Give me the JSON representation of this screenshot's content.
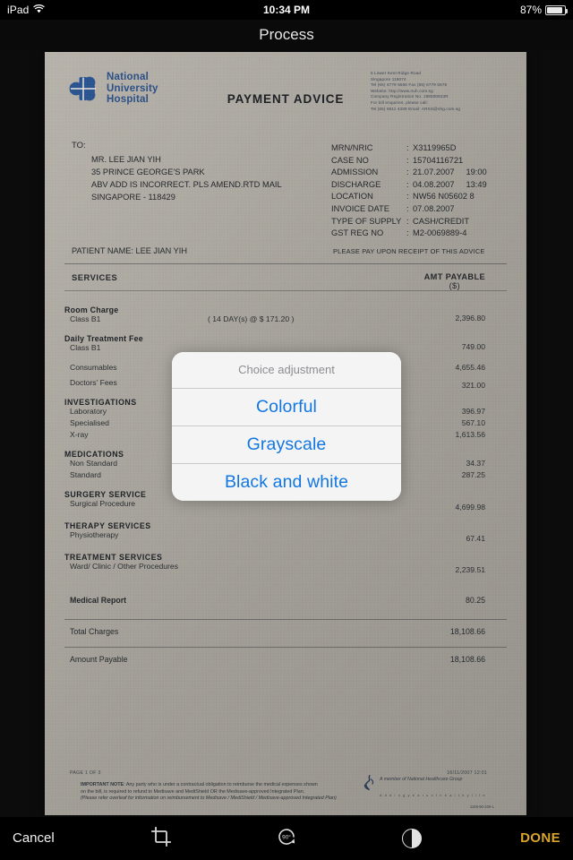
{
  "statusbar": {
    "device": "iPad",
    "wifi_icon": "wifi-icon",
    "time": "10:34 PM",
    "battery_percent": "87%",
    "battery_icon": "battery-icon"
  },
  "titlebar": {
    "title": "Process"
  },
  "document": {
    "logo": {
      "icon": "nuh-cross-logo-icon",
      "line1": "National",
      "line2": "University",
      "line3": "Hospital",
      "color": "#2a4f86"
    },
    "title": "PAYMENT ADVICE",
    "address_block": [
      "5 Lower Kent Ridge Road",
      "Singapore 119074",
      "Tel (65) 6779 5555 Fax (65) 6779 5678",
      "Website: http://www.nuh.com.sg",
      "Company Registration No. 198500843R",
      "For bill enquiries, please call:",
      "Tel (65) 6511 4338  Email: ARSS@nhg.com.sg"
    ],
    "to_label": "TO:",
    "to_lines": [
      "MR. LEE JIAN YIH",
      "35 PRINCE GEORGE'S PARK",
      "ABV ADD IS INCORRECT. PLS AMEND.RTD MAIL",
      "SINGAPORE - 118429"
    ],
    "meta": [
      {
        "key": "MRN/NRIC",
        "value": "X3119965D"
      },
      {
        "key": "CASE NO",
        "value": "15704116721"
      },
      {
        "key": "ADMISSION",
        "value": "21.07.2007     19:00"
      },
      {
        "key": "DISCHARGE",
        "value": "04.08.2007     13:49"
      },
      {
        "key": "LOCATION",
        "value": "NW56 N05602 8"
      },
      {
        "key": "INVOICE DATE",
        "value": "07.08.2007"
      },
      {
        "key": "TYPE OF SUPPLY",
        "value": "CASH/CREDIT"
      },
      {
        "key": "GST REG NO",
        "value": "M2-0069889-4"
      }
    ],
    "patient_name": "PATIENT NAME: LEE JIAN YIH",
    "pay_note": "PLEASE PAY UPON RECEIPT OF THIS ADVICE",
    "services_header": "SERVICES",
    "amount_header": "AMT PAYABLE",
    "amount_header_unit": "($)",
    "services": [
      {
        "group": "Room Charge",
        "name": "Class B1",
        "qty": "( 14 DAY(s) @ $ 171.20  )",
        "value": "2,396.80"
      },
      {
        "group": "Daily Treatment Fee",
        "name": "Class B1",
        "qty": "",
        "value": "749.00"
      },
      {
        "group": "Consumables",
        "name": "",
        "qty": "",
        "value": "4,655.46"
      },
      {
        "group": "Doctors' Fees",
        "name": "",
        "qty": "",
        "value": "321.00"
      }
    ],
    "service_groups": [
      {
        "title": "INVESTIGATIONS",
        "lines": [
          {
            "name": "Laboratory",
            "value": "396.97"
          },
          {
            "name": "Specialised",
            "value": "567.10"
          },
          {
            "name": "X-ray",
            "value": "1,613.56"
          }
        ]
      },
      {
        "title": "MEDICATIONS",
        "lines": [
          {
            "name": "Non Standard",
            "value": "34.37"
          },
          {
            "name": "Standard",
            "value": "287.25"
          }
        ]
      },
      {
        "title": "SURGERY SERVICE",
        "lines": [
          {
            "name": "Surgical Procedure",
            "value": "4,699.98"
          }
        ]
      },
      {
        "title": "THERAPY SERVICES",
        "lines": [
          {
            "name": "Physiotherapy",
            "value": "67.41"
          }
        ]
      },
      {
        "title": "TREATMENT SERVICES",
        "lines": [
          {
            "name": "Ward/ Clinic / Other Procedures",
            "value": "2,239.51"
          }
        ]
      }
    ],
    "medical_report": {
      "name": "Medical Report",
      "value": "80.25"
    },
    "total_charges": {
      "name": "Total Charges",
      "value": "18,108.66"
    },
    "amount_payable": {
      "name": "Amount Payable",
      "value": "18,108.66"
    },
    "footer": {
      "page": "PAGE 1 OF   3",
      "printed": "16/11/2007 12:01",
      "note_label": "IMPORTANT NOTE",
      "note_line1": ": Any party who is under a contractual obligation to reimburse the medical expenses shown",
      "note_line2": "on the bill, is required to refund to Medisave and MediShield OR the Medisave-approved Integrated Plan.",
      "note_line3": "(Please refer overleaf for information on reimbursement to Medisave / MediShield / Medisave-approved Integrated Plan)",
      "nhg_icon": "nhg-flame-logo-icon",
      "nhg_line1": "A member of National Healthcare Group",
      "nhg_line2": "A d d i n g   y e a r s   o f   h e a l t h y   l i f e",
      "nhg_code": "1109-90-209-L"
    }
  },
  "action_sheet": {
    "title": "Choice adjustment",
    "options": [
      {
        "label": "Colorful"
      },
      {
        "label": "Grayscale"
      },
      {
        "label": "Black and white"
      }
    ],
    "tint": "#1277e1"
  },
  "toolbar": {
    "cancel_label": "Cancel",
    "done_label": "DONE",
    "crop_icon": "crop-icon",
    "rotate_icon": "rotate-90-icon",
    "rotate_label": "90°",
    "contrast_icon": "contrast-icon",
    "done_color": "#d9a52a"
  }
}
